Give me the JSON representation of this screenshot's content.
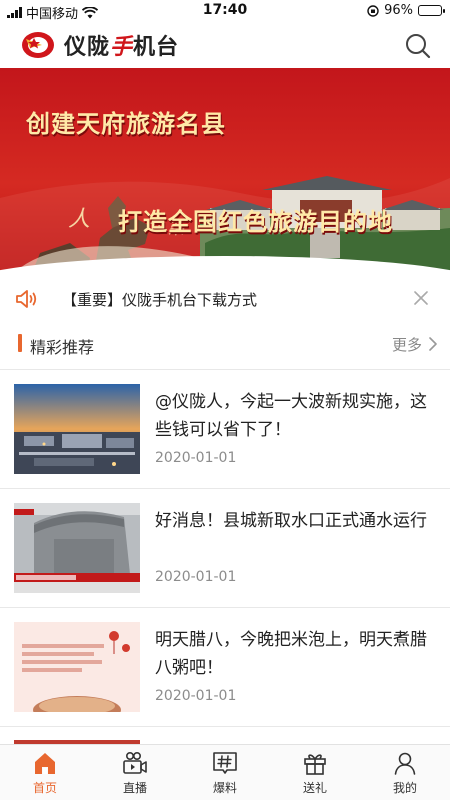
{
  "status_bar": {
    "carrier": "中国移动",
    "time": "17:40",
    "battery": "96%",
    "battery_level": 0.96
  },
  "header": {
    "app_name_prefix": "仪陇",
    "app_name_accent": "手",
    "app_name_suffix": "机台",
    "search_icon": "search-icon"
  },
  "banner": {
    "line1": "创建天府旅游名县",
    "line2": "打造全国红色旅游目的地",
    "slide_count": 3,
    "active_slide": 0
  },
  "notice": {
    "icon": "speaker-icon",
    "text": "【重要】仪陇手机台下载方式"
  },
  "section": {
    "title": "精彩推荐",
    "more_label": "更多"
  },
  "news": [
    {
      "title": "@仪陇人，今起一大波新规实施，这些钱可以省下了！",
      "date": "2020-01-01"
    },
    {
      "title": "好消息！县城新取水口正式通水运行",
      "date": "2020-01-01"
    },
    {
      "title": "明天腊八，今晚把米泡上，明天煮腊八粥吧！",
      "date": "2020-01-01"
    }
  ],
  "tabs": [
    {
      "label": "首页",
      "icon": "home-icon",
      "active": true
    },
    {
      "label": "直播",
      "icon": "video-camera-icon",
      "active": false
    },
    {
      "label": "爆料",
      "icon": "hashtag-icon",
      "active": false
    },
    {
      "label": "送礼",
      "icon": "gift-icon",
      "active": false
    },
    {
      "label": "我的",
      "icon": "user-icon",
      "active": false
    }
  ],
  "colors": {
    "accent": "#e8672f",
    "brand_red": "#d0161b"
  }
}
